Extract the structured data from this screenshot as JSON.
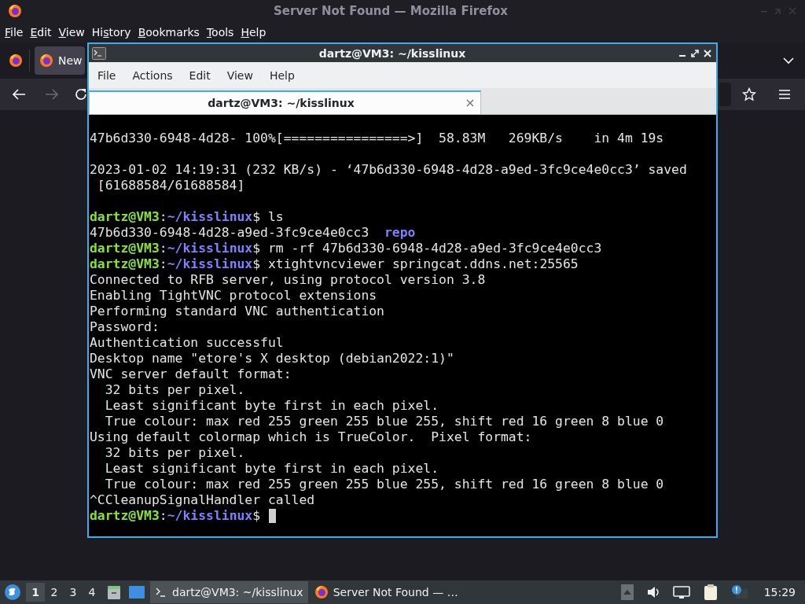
{
  "browser": {
    "title": "Server Not Found — Mozilla Firefox",
    "menu": [
      {
        "key": "F",
        "rest": "ile"
      },
      {
        "key": "E",
        "rest": "dit"
      },
      {
        "key": "V",
        "rest": "iew"
      },
      {
        "lead": "Hi",
        "key": "s",
        "rest": "tory"
      },
      {
        "key": "B",
        "rest": "ookmarks"
      },
      {
        "key": "T",
        "rest": "ools"
      },
      {
        "key": "H",
        "rest": "elp"
      }
    ],
    "tab": {
      "label": "New"
    },
    "nav": {
      "back_disabled": false,
      "forward_disabled": true
    }
  },
  "terminal": {
    "title": "dartz@VM3: ~/kisslinux",
    "menu": [
      "File",
      "Actions",
      "Edit",
      "View",
      "Help"
    ],
    "tabs": [
      {
        "label": "dartz@VM3: ~/kisslinux",
        "selected": true
      }
    ],
    "lines": [
      {
        "kind": "output",
        "text": "47b6d330-6948-4d28- 100%[================>]  58.83M   269KB/s    in 4m 19s"
      },
      {
        "kind": "blank"
      },
      {
        "kind": "output",
        "text": "2023-01-02 14:19:31 (232 KB/s) - ‘47b6d330-6948-4d28-a9ed-3fc9ce4e0cc3’ saved"
      },
      {
        "kind": "output",
        "text": " [61688584/61688584]"
      },
      {
        "kind": "blank"
      },
      {
        "kind": "prompt",
        "user_host": "dartz@VM3",
        "separator": ":",
        "path": "~/kisslinux",
        "symbol": "$",
        "command": "ls",
        "cursor": false
      },
      {
        "kind": "listing",
        "entries": [
          {
            "name": "47b6d330-6948-4d28-a9ed-3fc9ce4e0cc3",
            "kind": "file"
          },
          {
            "name": "repo",
            "kind": "directory"
          }
        ]
      },
      {
        "kind": "prompt",
        "user_host": "dartz@VM3",
        "separator": ":",
        "path": "~/kisslinux",
        "symbol": "$",
        "command": "rm -rf 47b6d330-6948-4d28-a9ed-3fc9ce4e0cc3",
        "cursor": false
      },
      {
        "kind": "prompt",
        "user_host": "dartz@VM3",
        "separator": ":",
        "path": "~/kisslinux",
        "symbol": "$",
        "command": "xtightvncviewer springcat.ddns.net:25565",
        "cursor": false
      },
      {
        "kind": "output",
        "text": "Connected to RFB server, using protocol version 3.8"
      },
      {
        "kind": "output",
        "text": "Enabling TightVNC protocol extensions"
      },
      {
        "kind": "output",
        "text": "Performing standard VNC authentication"
      },
      {
        "kind": "output",
        "text": "Password:"
      },
      {
        "kind": "output",
        "text": "Authentication successful"
      },
      {
        "kind": "output",
        "text": "Desktop name \"etore's X desktop (debian2022:1)\""
      },
      {
        "kind": "output",
        "text": "VNC server default format:"
      },
      {
        "kind": "output",
        "text": "  32 bits per pixel."
      },
      {
        "kind": "output",
        "text": "  Least significant byte first in each pixel."
      },
      {
        "kind": "output",
        "text": "  True colour: max red 255 green 255 blue 255, shift red 16 green 8 blue 0"
      },
      {
        "kind": "output",
        "text": "Using default colormap which is TrueColor.  Pixel format:"
      },
      {
        "kind": "output",
        "text": "  32 bits per pixel."
      },
      {
        "kind": "output",
        "text": "  Least significant byte first in each pixel."
      },
      {
        "kind": "output",
        "text": "  True colour: max red 255 green 255 blue 255, shift red 16 green 8 blue 0"
      },
      {
        "kind": "output",
        "text": "^CCleanupSignalHandler called"
      },
      {
        "kind": "prompt",
        "user_host": "dartz@VM3",
        "separator": ":",
        "path": "~/kisslinux",
        "symbol": "$",
        "cursor": true
      }
    ]
  },
  "taskbar": {
    "workspaces": [
      {
        "label": "1",
        "selected": true
      },
      {
        "label": "2",
        "selected": false
      },
      {
        "label": "3",
        "selected": false
      },
      {
        "label": "4",
        "selected": false
      }
    ],
    "tasks": [
      {
        "kind": "terminal",
        "label": "dartz@VM3: ~/kisslinux",
        "selected": true
      },
      {
        "kind": "browser",
        "label": "Server Not Found — …",
        "selected": false
      }
    ],
    "clock": "15:29"
  }
}
